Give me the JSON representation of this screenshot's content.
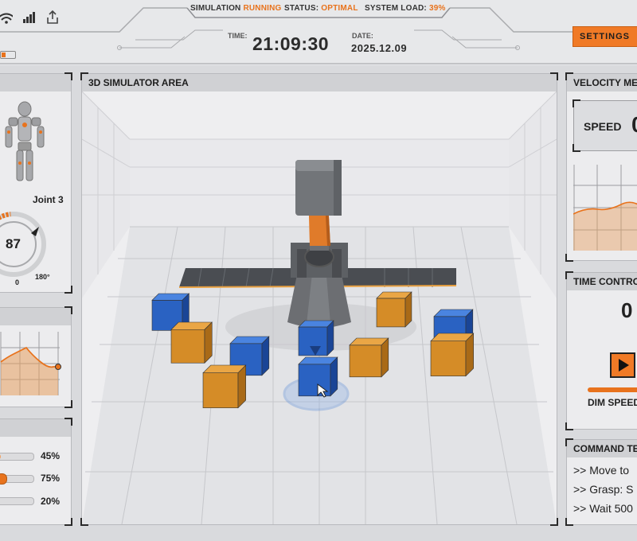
{
  "header": {
    "simulation_label": "SIMULATION",
    "simulation_state": "RUNNING",
    "status_label": "STATUS:",
    "status_value": "OPTIMAL",
    "load_label": "SYSTEM LOAD:",
    "load_value": "39%",
    "time_label": "TIME:",
    "time_value": "21:09:30",
    "date_label": "DATE:",
    "date_value": "2025.12.09",
    "settings_label": "SETTINGS",
    "battery_level": 0.3,
    "icons": [
      "wifi-icon",
      "signal-icon",
      "share-icon",
      "battery-icon"
    ]
  },
  "left": {
    "robot_panel": {
      "joint_label": "Joint 3",
      "joint_value": "87",
      "dial_min": "0",
      "dial_max": "180°",
      "dial_fraction": 0.48
    },
    "sliders": [
      {
        "value": "45%",
        "level": 0.45
      },
      {
        "value": "75%",
        "level": 0.75
      },
      {
        "value": "20%",
        "level": 0.2
      }
    ]
  },
  "center": {
    "title": "3D SIMULATOR AREA"
  },
  "right": {
    "velocity": {
      "title": "VELOCITY ME",
      "speed_label": "SPEED",
      "speed_value": "0"
    },
    "time_control": {
      "title": "TIME CONTRO",
      "value": "0",
      "dim_speed_label": "DIM SPEED"
    },
    "command": {
      "title": "COMMAND TE",
      "lines": [
        ">> Move to",
        ">> Grasp: S",
        ">> Wait 500"
      ]
    }
  },
  "colors": {
    "accent": "#e8731d",
    "cube_blue": "#2a62c2",
    "cube_orange": "#d58c27"
  }
}
